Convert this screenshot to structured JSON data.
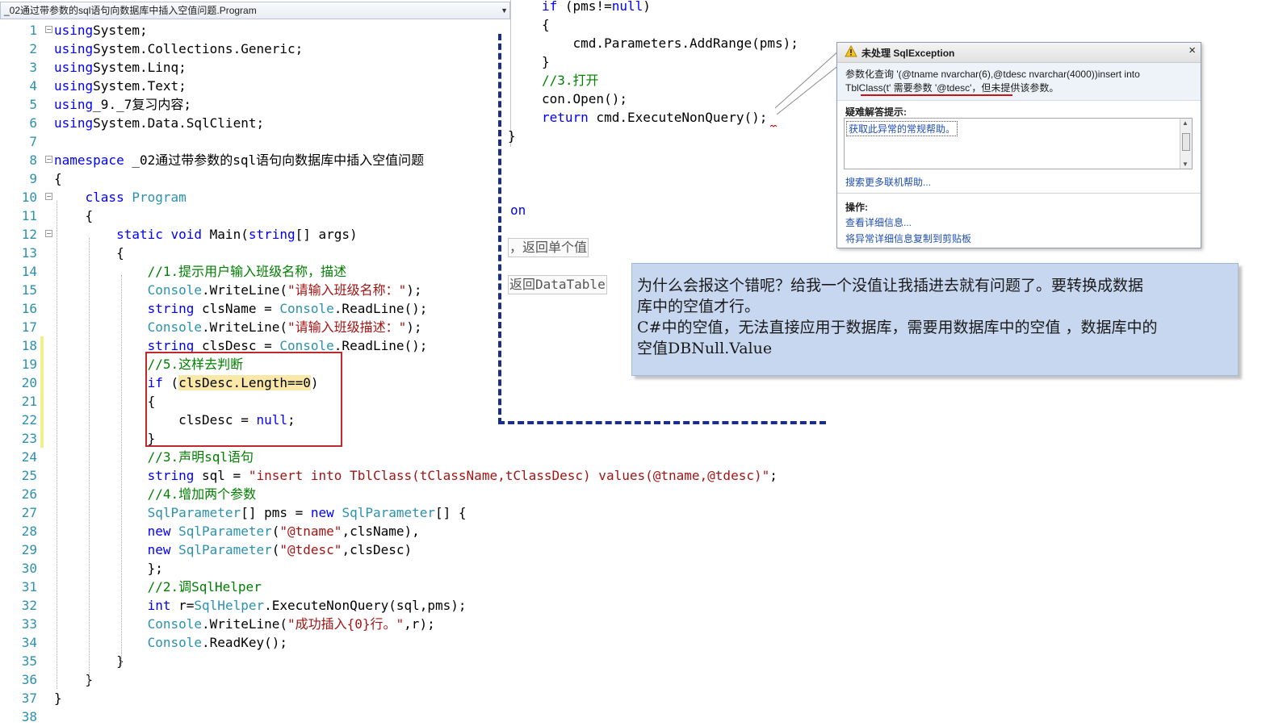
{
  "editor": {
    "class_dropdown": "_02通过带参数的sql语句向数据库中插入空值问题.Program",
    "left_lines": [
      {
        "n": "1",
        "tokens": [
          [
            "kw",
            "using"
          ],
          [
            "",
            "System;"
          ]
        ]
      },
      {
        "n": "2",
        "tokens": [
          [
            "kw",
            "using"
          ],
          [
            "",
            "System.Collections.Generic;"
          ]
        ]
      },
      {
        "n": "3",
        "tokens": [
          [
            "kw",
            "using"
          ],
          [
            "",
            "System.Linq;"
          ]
        ]
      },
      {
        "n": "4",
        "tokens": [
          [
            "kw",
            "using"
          ],
          [
            "",
            "System.Text;"
          ]
        ]
      },
      {
        "n": "5",
        "tokens": [
          [
            "kw",
            "using"
          ],
          [
            "",
            "_9._7复习内容;"
          ]
        ]
      },
      {
        "n": "6",
        "tokens": [
          [
            "kw",
            "using"
          ],
          [
            "",
            "System.Data.SqlClient;"
          ]
        ]
      },
      {
        "n": "7",
        "tokens": []
      },
      {
        "n": "8",
        "tokens": [
          [
            "kw",
            "namespace"
          ],
          [
            "",
            " _02通过带参数的sql语句向数据库中插入空值问题"
          ]
        ]
      },
      {
        "n": "9",
        "tokens": [
          [
            "",
            "{"
          ]
        ]
      },
      {
        "n": "10",
        "tokens": [
          [
            "",
            "    "
          ],
          [
            "kw",
            "class"
          ],
          [
            "",
            " "
          ],
          [
            "ty",
            "Program"
          ]
        ]
      },
      {
        "n": "11",
        "tokens": [
          [
            "",
            "    {"
          ]
        ]
      },
      {
        "n": "12",
        "tokens": [
          [
            "",
            "        "
          ],
          [
            "kw",
            "static void"
          ],
          [
            "",
            " Main("
          ],
          [
            "kw",
            "string"
          ],
          [
            "",
            "[] args)"
          ]
        ]
      },
      {
        "n": "13",
        "tokens": [
          [
            "",
            "        {"
          ]
        ]
      },
      {
        "n": "14",
        "tokens": [
          [
            "",
            "            "
          ],
          [
            "cm",
            "//1.提示用户输入班级名称，描述"
          ]
        ]
      },
      {
        "n": "15",
        "tokens": [
          [
            "",
            "            "
          ],
          [
            "ty",
            "Console"
          ],
          [
            "",
            ".WriteLine("
          ],
          [
            "st",
            "\"请输入班级名称：\""
          ],
          [
            "",
            ");"
          ]
        ]
      },
      {
        "n": "16",
        "tokens": [
          [
            "",
            "            "
          ],
          [
            "kw",
            "string"
          ],
          [
            "",
            " clsName = "
          ],
          [
            "ty",
            "Console"
          ],
          [
            "",
            ".ReadLine();"
          ]
        ]
      },
      {
        "n": "17",
        "tokens": [
          [
            "",
            "            "
          ],
          [
            "ty",
            "Console"
          ],
          [
            "",
            ".WriteLine("
          ],
          [
            "st",
            "\"请输入班级描述：\""
          ],
          [
            "",
            ");"
          ]
        ]
      },
      {
        "n": "18",
        "tokens": [
          [
            "",
            "            "
          ],
          [
            "kw",
            "string"
          ],
          [
            "",
            " clsDesc = "
          ],
          [
            "ty",
            "Console"
          ],
          [
            "",
            ".ReadLine();"
          ]
        ]
      },
      {
        "n": "19",
        "tokens": [
          [
            "",
            "            "
          ],
          [
            "cm",
            "//5.这样去判断"
          ]
        ]
      },
      {
        "n": "20",
        "tokens": [
          [
            "",
            "            "
          ],
          [
            "kw",
            "if"
          ],
          [
            "",
            " ("
          ],
          [
            "hl",
            "clsDesc.Length==0"
          ],
          [
            "",
            ")"
          ]
        ]
      },
      {
        "n": "21",
        "tokens": [
          [
            "",
            "            {"
          ]
        ]
      },
      {
        "n": "22",
        "tokens": [
          [
            "",
            "                clsDesc = "
          ],
          [
            "kw",
            "null"
          ],
          [
            "",
            ";"
          ]
        ]
      },
      {
        "n": "23",
        "tokens": [
          [
            "",
            "            }"
          ]
        ]
      },
      {
        "n": "24",
        "tokens": [
          [
            "",
            "            "
          ],
          [
            "cm",
            "//3.声明sql语句"
          ]
        ]
      },
      {
        "n": "25",
        "tokens": [
          [
            "",
            "            "
          ],
          [
            "kw",
            "string"
          ],
          [
            "",
            " sql = "
          ],
          [
            "st",
            "\"insert into TblClass(tClassName,tClassDesc) values(@tname,@tdesc)\""
          ],
          [
            "",
            ";"
          ]
        ]
      },
      {
        "n": "26",
        "tokens": [
          [
            "",
            "            "
          ],
          [
            "cm",
            "//4.增加两个参数"
          ]
        ]
      },
      {
        "n": "27",
        "tokens": [
          [
            "",
            "            "
          ],
          [
            "ty",
            "SqlParameter"
          ],
          [
            "",
            "[] pms = "
          ],
          [
            "kw",
            "new"
          ],
          [
            "",
            " "
          ],
          [
            "ty",
            "SqlParameter"
          ],
          [
            "",
            "[] {"
          ]
        ]
      },
      {
        "n": "28",
        "tokens": [
          [
            "",
            "            "
          ],
          [
            "kw",
            "new"
          ],
          [
            "",
            " "
          ],
          [
            "ty",
            "SqlParameter"
          ],
          [
            "",
            "("
          ],
          [
            "st",
            "\"@tname\""
          ],
          [
            "",
            ",clsName),"
          ]
        ]
      },
      {
        "n": "29",
        "tokens": [
          [
            "",
            "            "
          ],
          [
            "kw",
            "new"
          ],
          [
            "",
            " "
          ],
          [
            "ty",
            "SqlParameter"
          ],
          [
            "",
            "("
          ],
          [
            "st",
            "\"@tdesc\""
          ],
          [
            "",
            ",clsDesc)"
          ]
        ]
      },
      {
        "n": "30",
        "tokens": [
          [
            "",
            "            };"
          ]
        ]
      },
      {
        "n": "31",
        "tokens": [
          [
            "",
            "            "
          ],
          [
            "cm",
            "//2.调SqlHelper"
          ]
        ]
      },
      {
        "n": "32",
        "tokens": [
          [
            "",
            "            "
          ],
          [
            "kw",
            "int"
          ],
          [
            "",
            " r="
          ],
          [
            "ty",
            "SqlHelper"
          ],
          [
            "",
            ".ExecuteNonQuery(sql,pms);"
          ]
        ]
      },
      {
        "n": "33",
        "tokens": [
          [
            "",
            "            "
          ],
          [
            "ty",
            "Console"
          ],
          [
            "",
            ".WriteLine("
          ],
          [
            "st",
            "\"成功插入{0}行。\""
          ],
          [
            "",
            ",r);"
          ]
        ]
      },
      {
        "n": "34",
        "tokens": [
          [
            "",
            "            "
          ],
          [
            "ty",
            "Console"
          ],
          [
            "",
            ".ReadKey();"
          ]
        ]
      },
      {
        "n": "35",
        "tokens": [
          [
            "",
            "        }"
          ]
        ]
      },
      {
        "n": "36",
        "tokens": [
          [
            "",
            "    }"
          ]
        ]
      },
      {
        "n": "37",
        "tokens": [
          [
            "",
            "}"
          ]
        ]
      },
      {
        "n": "38",
        "tokens": []
      }
    ],
    "right_lines": [
      {
        "tokens": [
          [
            "kw",
            "if"
          ],
          [
            "",
            " (pms!="
          ],
          [
            "kw",
            "null"
          ],
          [
            "",
            ")"
          ]
        ]
      },
      {
        "tokens": [
          [
            "",
            "{"
          ]
        ]
      },
      {
        "tokens": [
          [
            "",
            "    cmd.Parameters.AddRange(pms);"
          ]
        ]
      },
      {
        "tokens": [
          [
            "",
            "}"
          ]
        ]
      },
      {
        "tokens": [
          [
            "cm",
            "//3.打开"
          ]
        ]
      },
      {
        "tokens": [
          [
            "",
            "con.Open();"
          ]
        ]
      },
      {
        "tokens": [
          [
            "kw",
            "return"
          ],
          [
            "",
            " cmd.ExecuteNonQuery();"
          ]
        ]
      }
    ],
    "right_close_brace": "}",
    "fragment_on": "on",
    "fragment_single": "，返回单个值",
    "fragment_datatable": "返回DataTable"
  },
  "exception": {
    "title": "未处理 SqlException",
    "close": "×",
    "message_line1": "参数化查询 '(@tname nvarchar(6),@tdesc nvarchar(4000))insert into",
    "message_line2": "TblClass(t' 需要参数 '@tdesc'，但未提供该参数。",
    "tips_heading": "疑难解答提示:",
    "tips_link": "获取此异常的常规帮助。",
    "more_help": "搜索更多联机帮助...",
    "actions_heading": "操作:",
    "action_details": "查看详细信息...",
    "action_copy": "将异常详细信息复制到剪贴板"
  },
  "note": {
    "line1": "为什么会报这个错呢？给我一个没值让我插进去就有问题了。要转换成数据",
    "line2": "库中的空值才行。",
    "line3": "C#中的空值，无法直接应用于数据库，需要用数据库中的空值 ，数据库中的",
    "line4": "空值DBNull.Value"
  },
  "colors": {
    "keyword": "#0000ff",
    "type": "#2b91af",
    "string": "#a31515",
    "comment": "#008000",
    "annotation_red": "#c0282e",
    "dash_blue": "#1a2c8c",
    "note_bg": "#c7d7ef"
  },
  "icons": {
    "warning": "warning-icon",
    "close": "close-icon",
    "fold": "collapse-icon"
  }
}
